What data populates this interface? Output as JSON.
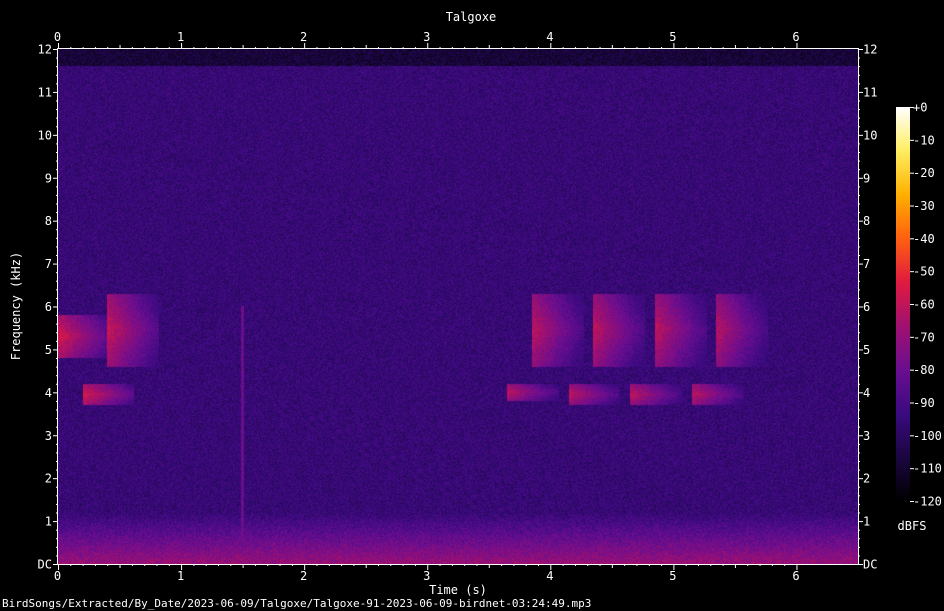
{
  "chart_data": {
    "type": "heatmap",
    "title": "Talgoxe",
    "xlabel": "Time (s)",
    "ylabel": "Frequency (kHz)",
    "xlim": [
      0,
      6.5
    ],
    "ylim": [
      0,
      12
    ],
    "x_ticks": [
      "0",
      "1",
      "2",
      "3",
      "4",
      "5",
      "6"
    ],
    "y_ticks": [
      "DC",
      "1",
      "2",
      "3",
      "4",
      "5",
      "6",
      "7",
      "8",
      "9",
      "10",
      "11",
      "12"
    ],
    "colorbar": {
      "label": "dBFS",
      "range": [
        -120,
        0
      ],
      "ticks": [
        "+0",
        "-10",
        "-20",
        "-30",
        "-40",
        "-50",
        "-60",
        "-70",
        "-80",
        "-90",
        "-100",
        "-110",
        "-120"
      ],
      "colormap": [
        "#000000",
        "#1a0640",
        "#3a0a80",
        "#6a0e90",
        "#a01070",
        "#e01a40",
        "#ff6010",
        "#ffb000",
        "#ffee60",
        "#ffffff"
      ]
    },
    "upper_cutoff_khz": 11.6,
    "calls": [
      {
        "t": 0.0,
        "f_low": 4.8,
        "f_high": 5.8,
        "level": -55
      },
      {
        "t": 0.2,
        "f_low": 3.7,
        "f_high": 4.2,
        "level": -55
      },
      {
        "t": 0.4,
        "f_low": 4.6,
        "f_high": 6.3,
        "level": -58
      },
      {
        "t": 3.65,
        "f_low": 3.8,
        "f_high": 4.2,
        "level": -60
      },
      {
        "t": 3.85,
        "f_low": 4.6,
        "f_high": 6.3,
        "level": -60
      },
      {
        "t": 4.15,
        "f_low": 3.7,
        "f_high": 4.2,
        "level": -60
      },
      {
        "t": 4.35,
        "f_low": 4.6,
        "f_high": 6.3,
        "level": -60
      },
      {
        "t": 4.65,
        "f_low": 3.7,
        "f_high": 4.2,
        "level": -60
      },
      {
        "t": 4.85,
        "f_low": 4.6,
        "f_high": 6.3,
        "level": -60
      },
      {
        "t": 5.15,
        "f_low": 3.7,
        "f_high": 4.2,
        "level": -60
      },
      {
        "t": 5.35,
        "f_low": 4.6,
        "f_high": 6.3,
        "level": -62
      }
    ],
    "transient": {
      "t": 1.5,
      "f_low": 0.5,
      "f_high": 6.0,
      "level": -80
    }
  },
  "file_path": "BirdSongs/Extracted/By_Date/2023-06-09/Talgoxe/Talgoxe-91-2023-06-09-birdnet-03:24:49.mp3"
}
